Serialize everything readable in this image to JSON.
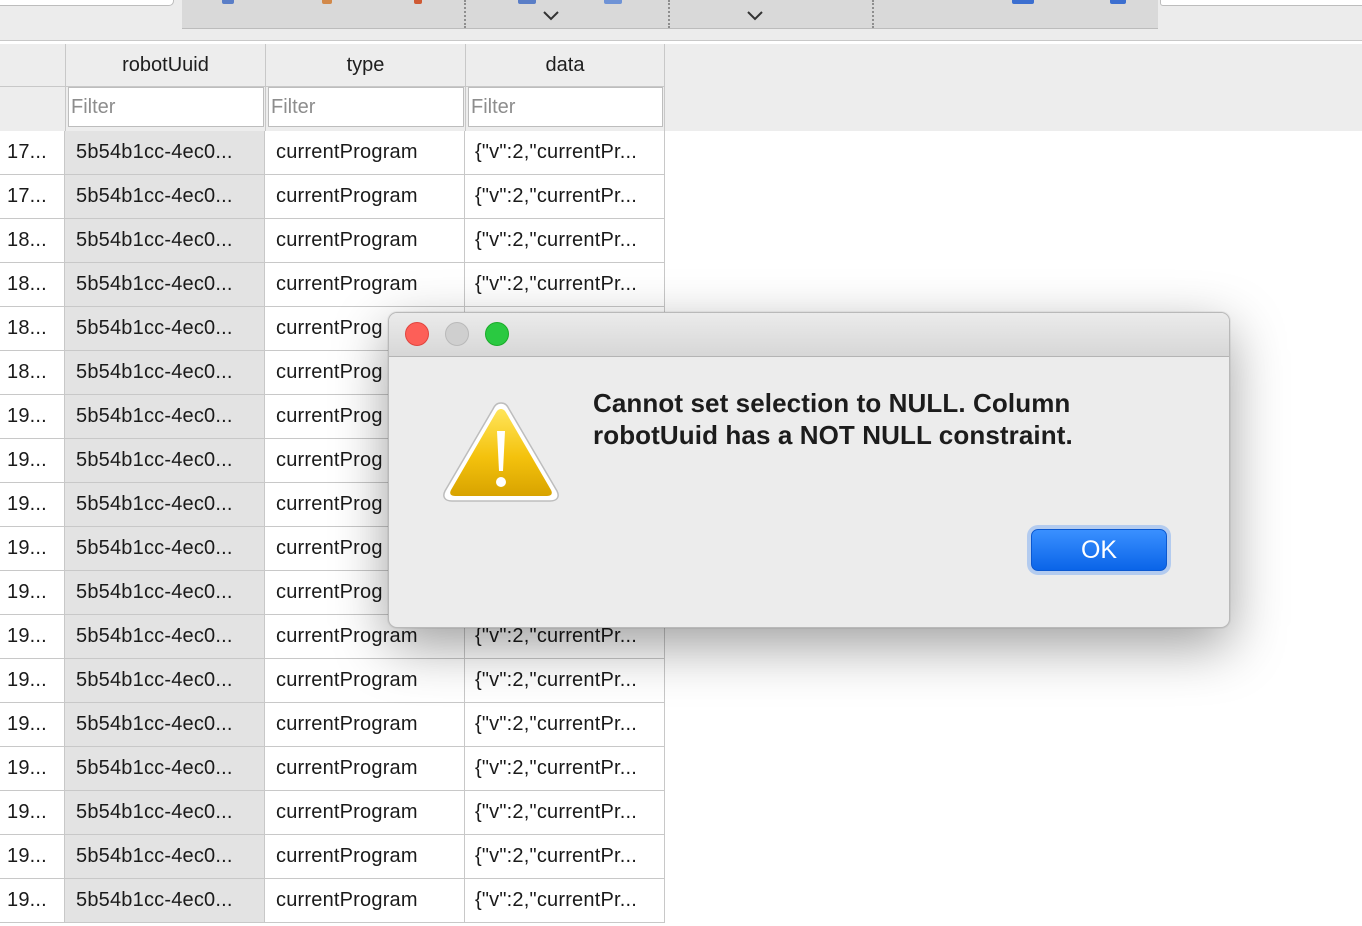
{
  "table": {
    "columns": [
      {
        "label": "robotUuid"
      },
      {
        "label": "type"
      },
      {
        "label": "data"
      }
    ],
    "filter_placeholder": "Filter",
    "rows": [
      {
        "id": "17...",
        "robotUuid": "5b54b1cc-4ec0...",
        "type": "currentProgram",
        "data": "{\"v\":2,\"currentPr..."
      },
      {
        "id": "17...",
        "robotUuid": "5b54b1cc-4ec0...",
        "type": "currentProgram",
        "data": "{\"v\":2,\"currentPr..."
      },
      {
        "id": "18...",
        "robotUuid": "5b54b1cc-4ec0...",
        "type": "currentProgram",
        "data": "{\"v\":2,\"currentPr..."
      },
      {
        "id": "18...",
        "robotUuid": "5b54b1cc-4ec0...",
        "type": "currentProgram",
        "data": "{\"v\":2,\"currentPr..."
      },
      {
        "id": "18...",
        "robotUuid": "5b54b1cc-4ec0...",
        "type": "currentProg",
        "data": ""
      },
      {
        "id": "18...",
        "robotUuid": "5b54b1cc-4ec0...",
        "type": "currentProg",
        "data": ""
      },
      {
        "id": "19...",
        "robotUuid": "5b54b1cc-4ec0...",
        "type": "currentProg",
        "data": ""
      },
      {
        "id": "19...",
        "robotUuid": "5b54b1cc-4ec0...",
        "type": "currentProg",
        "data": ""
      },
      {
        "id": "19...",
        "robotUuid": "5b54b1cc-4ec0...",
        "type": "currentProg",
        "data": ""
      },
      {
        "id": "19...",
        "robotUuid": "5b54b1cc-4ec0...",
        "type": "currentProg",
        "data": ""
      },
      {
        "id": "19...",
        "robotUuid": "5b54b1cc-4ec0...",
        "type": "currentProg",
        "data": ""
      },
      {
        "id": "19...",
        "robotUuid": "5b54b1cc-4ec0...",
        "type": "currentProgram",
        "data": "{\"v\":2,\"currentPr..."
      },
      {
        "id": "19...",
        "robotUuid": "5b54b1cc-4ec0...",
        "type": "currentProgram",
        "data": "{\"v\":2,\"currentPr..."
      },
      {
        "id": "19...",
        "robotUuid": "5b54b1cc-4ec0...",
        "type": "currentProgram",
        "data": "{\"v\":2,\"currentPr..."
      },
      {
        "id": "19...",
        "robotUuid": "5b54b1cc-4ec0...",
        "type": "currentProgram",
        "data": "{\"v\":2,\"currentPr..."
      },
      {
        "id": "19...",
        "robotUuid": "5b54b1cc-4ec0...",
        "type": "currentProgram",
        "data": "{\"v\":2,\"currentPr..."
      },
      {
        "id": "19...",
        "robotUuid": "5b54b1cc-4ec0...",
        "type": "currentProgram",
        "data": "{\"v\":2,\"currentPr..."
      },
      {
        "id": "19...",
        "robotUuid": "5b54b1cc-4ec0...",
        "type": "currentProgram",
        "data": "{\"v\":2,\"currentPr..."
      }
    ]
  },
  "dialog": {
    "icon": "warning-triangle-icon",
    "message": "Cannot set selection to NULL. Column robotUuid has a NOT NULL constraint.",
    "ok_label": "OK",
    "window_controls": [
      "close",
      "minimize",
      "zoom"
    ]
  },
  "colors": {
    "accent": "#1a73f0",
    "close": "#fd5f58",
    "zoom": "#2ac941",
    "warning": "#f2c200"
  }
}
